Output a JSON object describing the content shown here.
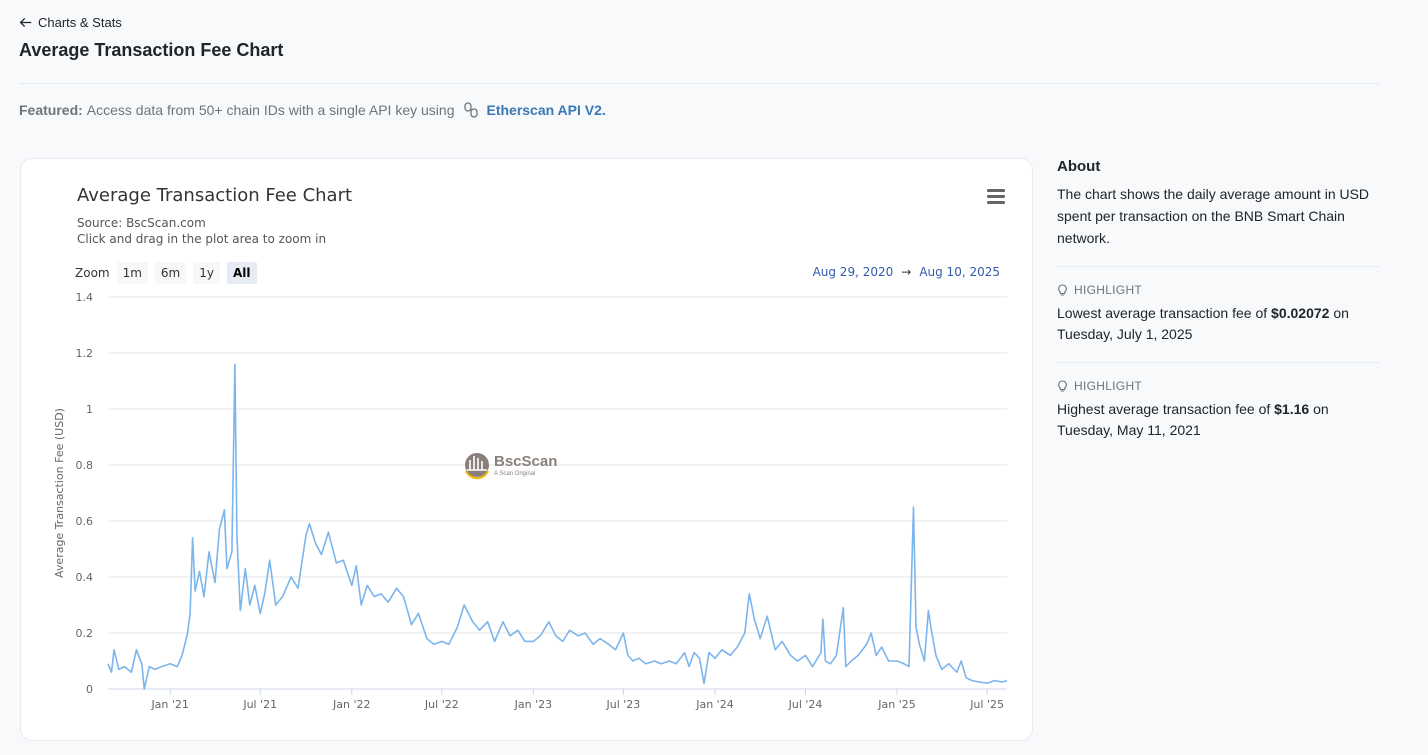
{
  "nav": {
    "back_label": "Charts & Stats"
  },
  "page": {
    "title": "Average Transaction Fee Chart"
  },
  "featured": {
    "label": "Featured:",
    "text": "Access data from 50+ chain IDs with a single API key using",
    "link": "Etherscan API V2."
  },
  "chart": {
    "title": "Average Transaction Fee Chart",
    "source": "Source: BscScan.com",
    "hint": "Click and drag in the plot area to zoom in",
    "zoom_label": "Zoom",
    "zoom_buttons": [
      "1m",
      "6m",
      "1y",
      "All"
    ],
    "zoom_active": "All",
    "range_from": "Aug 29, 2020",
    "range_arrow": "→",
    "range_to": "Aug 10, 2025",
    "watermark": {
      "name": "BscScan",
      "tagline": "A Scan Original"
    }
  },
  "chart_data": {
    "type": "line",
    "title": "Average Transaction Fee Chart",
    "subtitle": "Source: BscScan.com",
    "xlabel": "",
    "ylabel": "Average Transaction Fee (USD)",
    "ylim": [
      0,
      1.4
    ],
    "yticks": [
      "0",
      "0.2",
      "0.4",
      "0.6",
      "0.8",
      "1",
      "1.2",
      "1.4"
    ],
    "xlim": [
      "2020-08-29",
      "2025-08-10"
    ],
    "xticks": [
      {
        "date": "2021-01-01",
        "label": "Jan '21"
      },
      {
        "date": "2021-07-01",
        "label": "Jul '21"
      },
      {
        "date": "2022-01-01",
        "label": "Jan '22"
      },
      {
        "date": "2022-07-01",
        "label": "Jul '22"
      },
      {
        "date": "2023-01-01",
        "label": "Jan '23"
      },
      {
        "date": "2023-07-01",
        "label": "Jul '23"
      },
      {
        "date": "2024-01-01",
        "label": "Jan '24"
      },
      {
        "date": "2024-07-01",
        "label": "Jul '24"
      },
      {
        "date": "2025-01-01",
        "label": "Jan '25"
      },
      {
        "date": "2025-07-01",
        "label": "Jul '25"
      }
    ],
    "grid": true,
    "legend": "none",
    "color": "#7cb5ec",
    "series": [
      {
        "points": [
          [
            "2020-08-29",
            0.09
          ],
          [
            "2020-09-05",
            0.06
          ],
          [
            "2020-09-10",
            0.14
          ],
          [
            "2020-09-20",
            0.07
          ],
          [
            "2020-10-01",
            0.08
          ],
          [
            "2020-10-15",
            0.06
          ],
          [
            "2020-10-25",
            0.14
          ],
          [
            "2020-11-05",
            0.09
          ],
          [
            "2020-11-10",
            0.0
          ],
          [
            "2020-11-20",
            0.08
          ],
          [
            "2020-12-01",
            0.07
          ],
          [
            "2020-12-15",
            0.08
          ],
          [
            "2021-01-01",
            0.09
          ],
          [
            "2021-01-15",
            0.08
          ],
          [
            "2021-01-25",
            0.12
          ],
          [
            "2021-02-05",
            0.2
          ],
          [
            "2021-02-10",
            0.27
          ],
          [
            "2021-02-15",
            0.54
          ],
          [
            "2021-02-20",
            0.35
          ],
          [
            "2021-03-01",
            0.42
          ],
          [
            "2021-03-10",
            0.33
          ],
          [
            "2021-03-20",
            0.49
          ],
          [
            "2021-04-01",
            0.38
          ],
          [
            "2021-04-10",
            0.57
          ],
          [
            "2021-04-20",
            0.64
          ],
          [
            "2021-04-25",
            0.43
          ],
          [
            "2021-05-05",
            0.49
          ],
          [
            "2021-05-11",
            1.16
          ],
          [
            "2021-05-15",
            0.55
          ],
          [
            "2021-05-22",
            0.28
          ],
          [
            "2021-06-01",
            0.43
          ],
          [
            "2021-06-10",
            0.3
          ],
          [
            "2021-06-20",
            0.37
          ],
          [
            "2021-07-01",
            0.27
          ],
          [
            "2021-07-10",
            0.34
          ],
          [
            "2021-07-20",
            0.46
          ],
          [
            "2021-08-01",
            0.3
          ],
          [
            "2021-08-15",
            0.33
          ],
          [
            "2021-09-01",
            0.4
          ],
          [
            "2021-09-15",
            0.36
          ],
          [
            "2021-10-01",
            0.55
          ],
          [
            "2021-10-08",
            0.59
          ],
          [
            "2021-10-20",
            0.52
          ],
          [
            "2021-11-01",
            0.48
          ],
          [
            "2021-11-15",
            0.56
          ],
          [
            "2021-12-01",
            0.45
          ],
          [
            "2021-12-15",
            0.46
          ],
          [
            "2022-01-01",
            0.37
          ],
          [
            "2022-01-10",
            0.44
          ],
          [
            "2022-01-20",
            0.3
          ],
          [
            "2022-02-01",
            0.37
          ],
          [
            "2022-02-15",
            0.33
          ],
          [
            "2022-03-01",
            0.34
          ],
          [
            "2022-03-15",
            0.31
          ],
          [
            "2022-04-01",
            0.36
          ],
          [
            "2022-04-15",
            0.33
          ],
          [
            "2022-05-01",
            0.23
          ],
          [
            "2022-05-15",
            0.27
          ],
          [
            "2022-06-01",
            0.18
          ],
          [
            "2022-06-15",
            0.16
          ],
          [
            "2022-07-01",
            0.17
          ],
          [
            "2022-07-15",
            0.16
          ],
          [
            "2022-08-01",
            0.22
          ],
          [
            "2022-08-15",
            0.3
          ],
          [
            "2022-09-01",
            0.24
          ],
          [
            "2022-09-15",
            0.21
          ],
          [
            "2022-10-01",
            0.24
          ],
          [
            "2022-10-15",
            0.17
          ],
          [
            "2022-11-01",
            0.24
          ],
          [
            "2022-11-15",
            0.19
          ],
          [
            "2022-12-01",
            0.21
          ],
          [
            "2022-12-15",
            0.17
          ],
          [
            "2023-01-01",
            0.17
          ],
          [
            "2023-01-15",
            0.19
          ],
          [
            "2023-02-01",
            0.24
          ],
          [
            "2023-02-15",
            0.19
          ],
          [
            "2023-03-01",
            0.17
          ],
          [
            "2023-03-15",
            0.21
          ],
          [
            "2023-04-01",
            0.19
          ],
          [
            "2023-04-15",
            0.2
          ],
          [
            "2023-05-01",
            0.16
          ],
          [
            "2023-05-15",
            0.18
          ],
          [
            "2023-06-01",
            0.16
          ],
          [
            "2023-06-15",
            0.14
          ],
          [
            "2023-07-01",
            0.2
          ],
          [
            "2023-07-10",
            0.12
          ],
          [
            "2023-07-20",
            0.1
          ],
          [
            "2023-08-01",
            0.11
          ],
          [
            "2023-08-15",
            0.09
          ],
          [
            "2023-09-01",
            0.1
          ],
          [
            "2023-09-15",
            0.09
          ],
          [
            "2023-10-01",
            0.1
          ],
          [
            "2023-10-15",
            0.09
          ],
          [
            "2023-11-01",
            0.13
          ],
          [
            "2023-11-10",
            0.08
          ],
          [
            "2023-11-20",
            0.13
          ],
          [
            "2023-12-01",
            0.11
          ],
          [
            "2023-12-10",
            0.02
          ],
          [
            "2023-12-20",
            0.13
          ],
          [
            "2024-01-01",
            0.11
          ],
          [
            "2024-01-15",
            0.14
          ],
          [
            "2024-02-01",
            0.12
          ],
          [
            "2024-02-15",
            0.15
          ],
          [
            "2024-03-01",
            0.2
          ],
          [
            "2024-03-10",
            0.34
          ],
          [
            "2024-03-20",
            0.25
          ],
          [
            "2024-04-01",
            0.18
          ],
          [
            "2024-04-15",
            0.26
          ],
          [
            "2024-05-01",
            0.14
          ],
          [
            "2024-05-15",
            0.17
          ],
          [
            "2024-06-01",
            0.12
          ],
          [
            "2024-06-15",
            0.1
          ],
          [
            "2024-07-01",
            0.12
          ],
          [
            "2024-07-15",
            0.08
          ],
          [
            "2024-08-01",
            0.13
          ],
          [
            "2024-08-05",
            0.25
          ],
          [
            "2024-08-10",
            0.1
          ],
          [
            "2024-08-20",
            0.09
          ],
          [
            "2024-09-01",
            0.12
          ],
          [
            "2024-09-15",
            0.29
          ],
          [
            "2024-09-20",
            0.08
          ],
          [
            "2024-10-01",
            0.1
          ],
          [
            "2024-10-15",
            0.12
          ],
          [
            "2024-11-01",
            0.16
          ],
          [
            "2024-11-10",
            0.2
          ],
          [
            "2024-11-20",
            0.12
          ],
          [
            "2024-12-01",
            0.15
          ],
          [
            "2024-12-15",
            0.1
          ],
          [
            "2025-01-01",
            0.1
          ],
          [
            "2025-01-15",
            0.09
          ],
          [
            "2025-01-25",
            0.08
          ],
          [
            "2025-02-03",
            0.65
          ],
          [
            "2025-02-08",
            0.22
          ],
          [
            "2025-02-15",
            0.16
          ],
          [
            "2025-02-25",
            0.1
          ],
          [
            "2025-03-05",
            0.28
          ],
          [
            "2025-03-10",
            0.22
          ],
          [
            "2025-03-20",
            0.12
          ],
          [
            "2025-04-01",
            0.07
          ],
          [
            "2025-04-15",
            0.09
          ],
          [
            "2025-05-01",
            0.06
          ],
          [
            "2025-05-10",
            0.1
          ],
          [
            "2025-05-20",
            0.04
          ],
          [
            "2025-06-01",
            0.03
          ],
          [
            "2025-06-15",
            0.025
          ],
          [
            "2025-07-01",
            0.02072
          ],
          [
            "2025-07-15",
            0.03
          ],
          [
            "2025-08-01",
            0.025
          ],
          [
            "2025-08-10",
            0.03
          ]
        ]
      }
    ]
  },
  "about": {
    "title": "About",
    "text": "The chart shows the daily average amount in USD spent per transaction on the BNB Smart Chain network.",
    "highlight_label": "HIGHLIGHT",
    "lowest_prefix": "Lowest average transaction fee of ",
    "lowest_value": "$0.02072",
    "lowest_suffix": " on",
    "lowest_date": "Tuesday, July 1, 2025",
    "highest_prefix": "Highest average transaction fee of ",
    "highest_value": "$1.16",
    "highest_suffix": " on",
    "highest_date": "Tuesday, May 11, 2021"
  }
}
